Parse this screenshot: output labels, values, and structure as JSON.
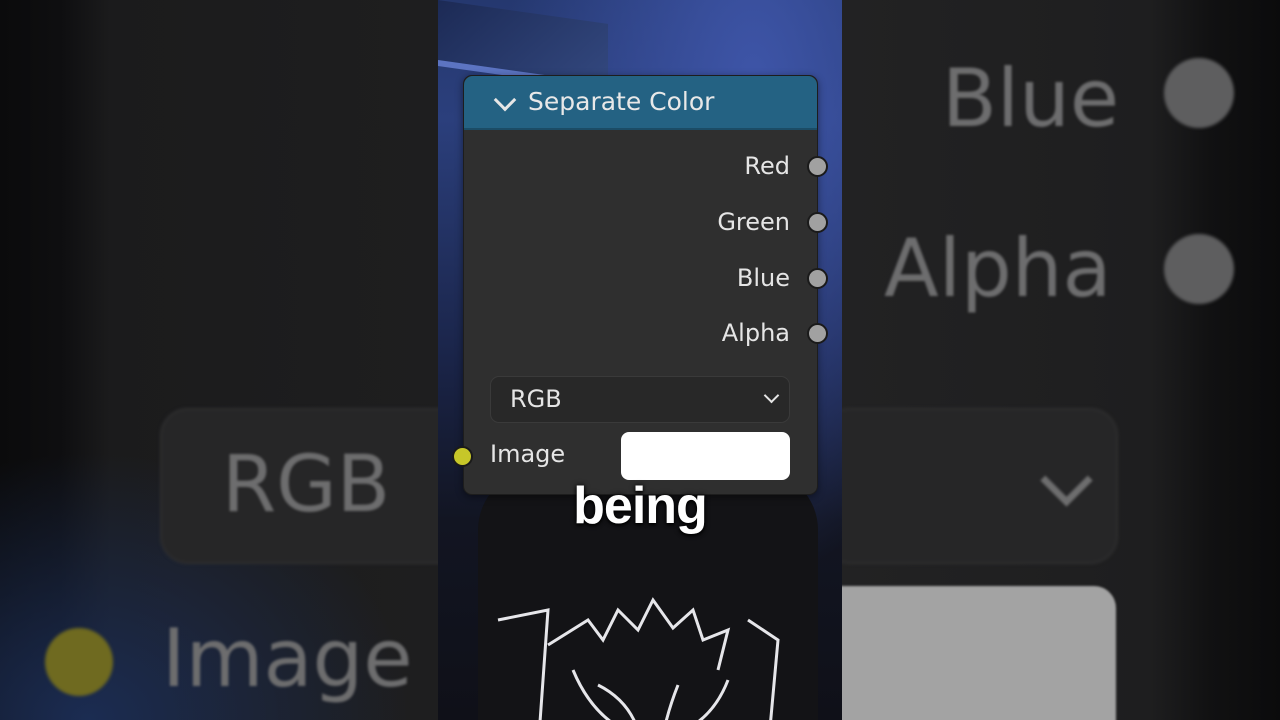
{
  "node": {
    "title": "Separate Color",
    "outputs": [
      {
        "label": "Red"
      },
      {
        "label": "Green"
      },
      {
        "label": "Blue"
      },
      {
        "label": "Alpha"
      }
    ],
    "mode_value": "RGB",
    "input_label": "Image",
    "input_color": "#ffffff",
    "header_color": "#246283",
    "output_socket_color": "#a1a1a1",
    "input_socket_color": "#c7c729"
  },
  "backdrop": {
    "labels": [
      "Blue",
      "Alpha",
      "RGB",
      "Image"
    ]
  },
  "caption": "being"
}
